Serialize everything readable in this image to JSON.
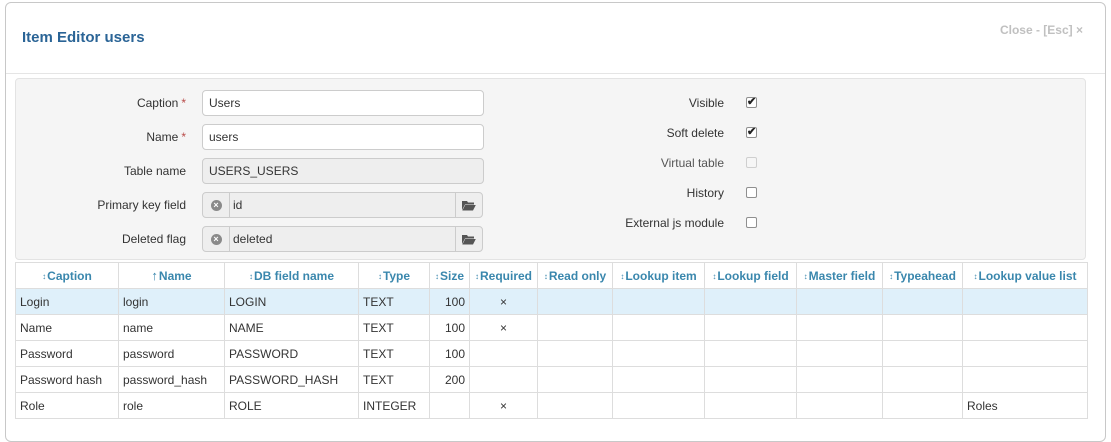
{
  "modal": {
    "title": "Item Editor",
    "item_name": "users",
    "close_label": "Close - [Esc] ×"
  },
  "form": {
    "caption": {
      "label": "Caption",
      "value": "Users"
    },
    "name": {
      "label": "Name",
      "value": "users"
    },
    "table_name": {
      "label": "Table name",
      "value": "USERS_USERS"
    },
    "primary_key": {
      "label": "Primary key field",
      "value": "id"
    },
    "deleted_flag": {
      "label": "Deleted flag",
      "value": "deleted"
    },
    "required_mark": "*",
    "visible": {
      "label": "Visible",
      "checked": true
    },
    "soft_delete": {
      "label": "Soft delete",
      "checked": true
    },
    "virtual_table": {
      "label": "Virtual table",
      "checked": false,
      "disabled": true
    },
    "history": {
      "label": "History",
      "checked": false
    },
    "external_js": {
      "label": "External js module",
      "checked": false
    }
  },
  "grid": {
    "columns": [
      "Caption",
      "Name",
      "DB field name",
      "Type",
      "Size",
      "Required",
      "Read only",
      "Lookup item",
      "Lookup field",
      "Master field",
      "Typeahead",
      "Lookup value list"
    ],
    "sorted_column": "Name",
    "rows": [
      [
        "Login",
        "login",
        "LOGIN",
        "TEXT",
        "100",
        "×",
        "",
        "",
        "",
        "",
        "",
        ""
      ],
      [
        "Name",
        "name",
        "NAME",
        "TEXT",
        "100",
        "×",
        "",
        "",
        "",
        "",
        "",
        ""
      ],
      [
        "Password",
        "password",
        "PASSWORD",
        "TEXT",
        "100",
        "",
        "",
        "",
        "",
        "",
        "",
        ""
      ],
      [
        "Password hash",
        "password_hash",
        "PASSWORD_HASH",
        "TEXT",
        "200",
        "",
        "",
        "",
        "",
        "",
        "",
        ""
      ],
      [
        "Role",
        "role",
        "ROLE",
        "INTEGER",
        "",
        "×",
        "",
        "",
        "",
        "",
        "",
        "Roles"
      ]
    ],
    "selected_row": 0
  },
  "icons": {
    "clear": "clear-circle-icon",
    "open": "folder-open-icon",
    "sort": "sort-icon",
    "sort_asc": "sort-ascending-icon"
  },
  "colors": {
    "title": "#2a6496",
    "header_text": "#3a87ad",
    "selected_row": "#dff0fa",
    "required": "#b94a48"
  }
}
